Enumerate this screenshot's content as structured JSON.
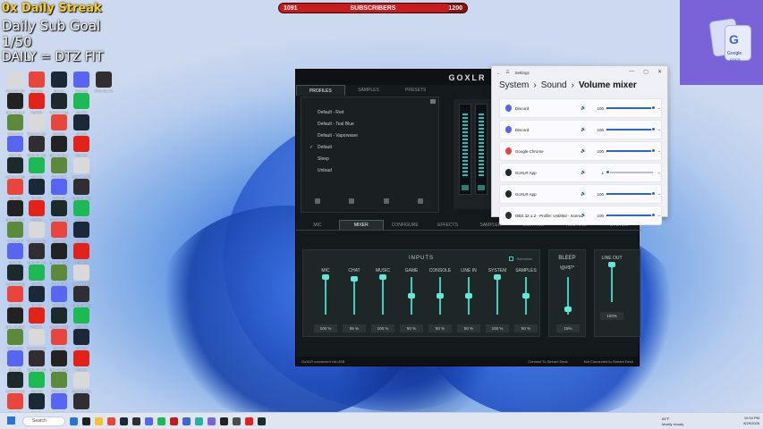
{
  "overlay": {
    "streak": "0x Daily Streak",
    "sub_goal_label": "Daily Sub Goal",
    "sub_goal_count": "1/50",
    "daily": "DAILY = DTZ FIT"
  },
  "subscriber_bar": {
    "current": "1091",
    "label": "SUBSCRIBERS",
    "goal": "1200",
    "progress": 0.9092
  },
  "desktop_icons": [
    {
      "label": "Recycle Bin",
      "color": "#d9d9d9"
    },
    {
      "label": "Google Chrome",
      "color": "#e8453c"
    },
    {
      "label": "Steam",
      "color": "#1b2838"
    },
    {
      "label": "Discord",
      "color": "#5865f2"
    },
    {
      "label": "OBS Studio",
      "color": "#302e31"
    },
    {
      "label": "Epic Games",
      "color": "#222222"
    },
    {
      "label": "Roblox",
      "color": "#e2231a"
    },
    {
      "label": "GoXLR App",
      "color": "#1c2a2c"
    },
    {
      "label": "Spotify",
      "color": "#1db954"
    },
    {
      "label": "Minecraft",
      "color": "#5c8a3a"
    }
  ],
  "goxlr": {
    "logo": "GOXLR",
    "profile_tabs": [
      "PROFILES",
      "SAMPLES",
      "PRESETS"
    ],
    "profiles": [
      {
        "name": "Default - Red",
        "selected": false
      },
      {
        "name": "Default - Teal Blue",
        "selected": false
      },
      {
        "name": "Default - Vaporwave",
        "selected": false
      },
      {
        "name": "Default",
        "selected": true
      },
      {
        "name": "Sleep",
        "selected": false
      },
      {
        "name": "Unload",
        "selected": false
      }
    ],
    "main_tabs": [
      "MIC",
      "MIXER",
      "CONFIGURE",
      "EFFECTS",
      "SAMPLER",
      "LIGHTING",
      "ROUTING",
      "SYSTEM"
    ],
    "active_tab": "MIXER",
    "inputs_title": "INPUTS",
    "submixes_label": "Submixes",
    "channels": [
      {
        "name": "MIC",
        "value": "100 %",
        "level": 1.0
      },
      {
        "name": "CHAT",
        "value": "95 %",
        "level": 0.95
      },
      {
        "name": "MUSIC",
        "value": "100 %",
        "level": 1.0
      },
      {
        "name": "GAME",
        "value": "50 %",
        "level": 0.5
      },
      {
        "name": "CONSOLE",
        "value": "50 %",
        "level": 0.5
      },
      {
        "name": "LINE IN",
        "value": "50 %",
        "level": 0.5
      },
      {
        "name": "SYSTEM",
        "value": "100 %",
        "level": 1.0
      },
      {
        "name": "SAMPLES",
        "value": "50 %",
        "level": 0.5
      }
    ],
    "bleep": {
      "title": "BLEEP",
      "sub": "!@#$?*",
      "value": "15%",
      "level": 0.15
    },
    "line_out": {
      "name": "LINE OUT",
      "value": "100%",
      "level": 1.0
    },
    "status_left": "GoXLR connected via USB",
    "status_mid": "Connect To Stream Deck",
    "status_right": "Not Connected to Stream Deck"
  },
  "settings": {
    "app_title": "Settings",
    "breadcrumb": [
      "System",
      "Sound",
      "Volume mixer"
    ],
    "apps": [
      {
        "name": "Discord",
        "volume": "100",
        "level": 1.0,
        "color": "#5865f2"
      },
      {
        "name": "Discord",
        "volume": "100",
        "level": 1.0,
        "color": "#5865f2"
      },
      {
        "name": "Google Chrome",
        "volume": "100",
        "level": 1.0,
        "color": "#e8453c"
      },
      {
        "name": "GoXLR App",
        "volume": "1",
        "level": 0.01,
        "color": "#1c2a2c"
      },
      {
        "name": "GoXLR App",
        "volume": "100",
        "level": 1.0,
        "color": "#1c2a2c"
      },
      {
        "name": "OBS 32.1.2 - Profile: Untitled - Scenes",
        "volume": "100",
        "level": 1.0,
        "color": "#302e31"
      }
    ]
  },
  "google_drive": {
    "label": "Google",
    "sub": "DOCS"
  },
  "taskbar": {
    "search_placeholder": "Search",
    "weather_temp": "64°F",
    "weather_desc": "Mostly cloudy",
    "time": "10:34 PM",
    "date": "8/29/2026"
  }
}
